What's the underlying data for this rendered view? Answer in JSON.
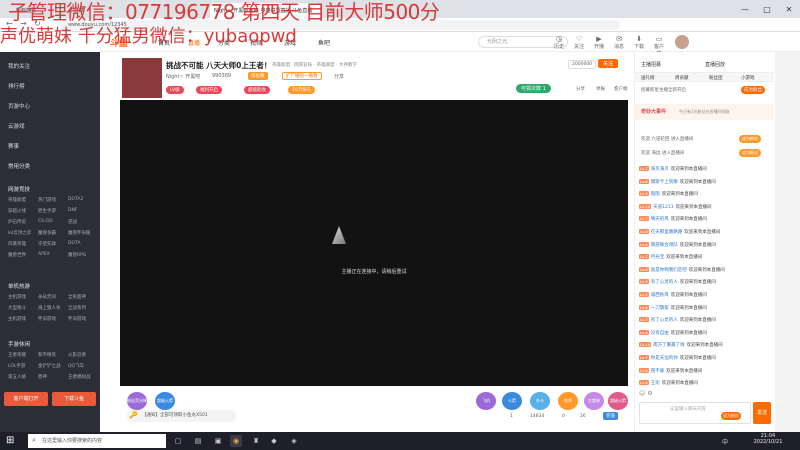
{
  "overlay": {
    "line1": "子管理微信：077196778    第四天 目前大师500分",
    "line2": "声优萌妹 千分猛男微信：yubaopwd"
  },
  "browser": {
    "tabs": [
      {
        "label": "新标签页",
        "active": false
      },
      {
        "label": "…中分享",
        "active": false
      },
      {
        "label": "Night~ 开黑吧直播_英雄联盟直播 斗鱼直播",
        "active": true
      },
      {
        "label": "+",
        "active": false
      }
    ],
    "address": "www.douyu.com/12345",
    "window_controls": [
      "—",
      "□",
      "✕"
    ]
  },
  "site": {
    "logo": "斗鱼",
    "nav": [
      "首页",
      "直播",
      "分类",
      "视频",
      "游戏",
      "鱼吧"
    ],
    "search_placeholder": "光阴之光",
    "top_icons": [
      "历史",
      "关注",
      "开播",
      "消息",
      "下载",
      "客户端"
    ]
  },
  "sidebar": {
    "items": [
      "我的关注",
      "排行榜",
      "页游中心",
      "云游戏",
      "赛事"
    ],
    "section_common": "常用分类",
    "section_hot": "网游竞技",
    "hot_cells": [
      "英雄联盟",
      "热门游戏",
      "DOTA2",
      "穿越火线",
      "原生手游",
      "DNF",
      "炉石传说",
      "CS:GO",
      "逆战",
      "lol云顶之弈",
      "魔兽争霸",
      "魔兽怀旧服",
      "风暴英雄",
      "守望先锋",
      "DOTA",
      "魔兽世界",
      "APEX",
      "魔兽RPG"
    ],
    "section_single": "单机热游",
    "single_cells": [
      "主机游戏",
      "永劫无间",
      "全民超神",
      "大型格斗",
      "海上狼人杀",
      "全战系列",
      "主机游戏",
      "怀旧游戏",
      "怀旧游戏"
    ],
    "section_mobile": "手游休闲",
    "mobile_cells": [
      "王者荣耀",
      "和平精英",
      "火影忍者",
      "LOL手游",
      "金铲铲之战",
      "QQ飞车",
      "第五人格",
      "原神",
      "王者模拟战"
    ],
    "btn_client": "客户端打开",
    "btn_download": "下载斗鱼"
  },
  "room": {
    "title": "挑战不可能 八天大师0上王者！",
    "category_tags": [
      "英雄联盟",
      "网游竞技",
      "英雄联盟",
      "大神教学"
    ],
    "streamer": "Night~ 开黑吧",
    "room_id": "990389",
    "badge1": "排位赛",
    "badge2": "扩广播陪一瓶香",
    "fans_label": "分享",
    "follow_label": "关注",
    "follow_count": "2000600",
    "tags": [
      "LV级",
      "福利开启",
      "超级助攻",
      "10万份礼"
    ],
    "watch_label": "可领次数 1",
    "sub_links": [
      "分享",
      "举报",
      "客户端"
    ]
  },
  "video": {
    "loading_text": "主播正在连接中，请稍后重试"
  },
  "bottom": {
    "announce": "【通知】全部可领取小鱼丸X501",
    "gifts": [
      "粉丝荧光棒",
      "超级火箭",
      "飞机",
      "火箭",
      "办卡",
      "吃鸡",
      "大超神",
      "超级火箭"
    ],
    "counts": [
      "1",
      "14834",
      "0",
      "26"
    ],
    "recharge": "充值"
  },
  "chat": {
    "tabs": [
      "主播招募",
      "直播回放"
    ],
    "subtabs": [
      "送礼榜",
      "周贡献",
      "粉丝团",
      "小游戏"
    ],
    "notice": "招募新星主播全新开启",
    "notice_btn": "成为粉丝",
    "event_title": "奇妙大事件",
    "event_desc": "今日有1位粉丝在直播间领取",
    "enter_lines": [
      "欢迎 六道轮回 进入直播间",
      "欢迎 海边 进入直播间"
    ],
    "enter_btn": "成为粉丝",
    "messages": [
      {
        "lvl": "Lv.7",
        "user": "海贝海贝",
        "text": "欢迎来到本直播间"
      },
      {
        "lvl": "Lv.8",
        "user": "摩斯卡上到哪",
        "text": "欢迎来到本直播间"
      },
      {
        "lvl": "Lv.5",
        "user": "陌陌",
        "text": "欢迎来到本直播间"
      },
      {
        "lvl": "Lv.10",
        "user": "天道1213",
        "text": "欢迎来到本直播间"
      },
      {
        "lvl": "Lv.7",
        "user": "晴天的风",
        "text": "欢迎来到本直播间"
      },
      {
        "lvl": "Lv.6",
        "user": "在天那里路路路",
        "text": "欢迎来到本直播间"
      },
      {
        "lvl": "Lv.8",
        "user": "南部联合领队",
        "text": "欢迎来到本直播间"
      },
      {
        "lvl": "Lv.7",
        "user": "月光宝",
        "text": "欢迎来到本直播间"
      },
      {
        "lvl": "Lv.9",
        "user": "就是你啊我们走吧",
        "text": "欢迎来到本直播间"
      },
      {
        "lvl": "Lv.6",
        "user": "有了心灵的人",
        "text": "欢迎来到本直播间"
      },
      {
        "lvl": "Lv.5",
        "user": "城西秋风",
        "text": "欢迎来到本直播间"
      },
      {
        "lvl": "Lv.8",
        "user": "一刀飘絮",
        "text": "欢迎来到本直播间"
      },
      {
        "lvl": "Lv.7",
        "user": "有了心灵的人",
        "text": "欢迎来到本直播间"
      },
      {
        "lvl": "Lv.6",
        "user": "没有自由",
        "text": "欢迎来到本直播间"
      },
      {
        "lvl": "Lv.10",
        "user": "南方了雾最了啦",
        "text": "欢迎来到本直播间"
      },
      {
        "lvl": "Lv.7",
        "user": "你是天边的你",
        "text": "欢迎来到本直播间"
      },
      {
        "lvl": "Lv.8",
        "user": "夜不寐",
        "text": "欢迎来到本直播间"
      },
      {
        "lvl": "Lv.6",
        "user": "王珩",
        "text": "欢迎来到本直播间"
      }
    ],
    "input_placeholder": "这里输入聊天内容",
    "send_btn": "发送",
    "badge_btn": "成为粉丝"
  },
  "taskbar": {
    "search_placeholder": "在这里输入你要搜索的内容",
    "time": "21:04",
    "date": "2022/10/21",
    "lang": "中"
  },
  "colors": {
    "accent": "#ff6a00",
    "sidebar_bg": "#2b2e38",
    "overlay_text": "#d83a3a"
  }
}
